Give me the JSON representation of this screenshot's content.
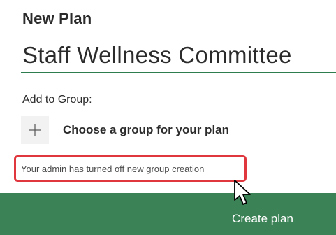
{
  "dialog": {
    "title": "New Plan",
    "plan_name_value": "Staff Wellness Committee",
    "add_to_group_label": "Add to Group:",
    "choose_group_text": "Choose a group for your plan",
    "warning_text": "Your admin has turned off new group creation",
    "create_plan_label": "Create plan"
  },
  "colors": {
    "accent_green": "#3c8257",
    "warning_red": "#e0363d",
    "field_underline": "#2e7d4f"
  },
  "icons": {
    "add_group": "plus-icon",
    "pointer": "mouse-pointer-icon"
  }
}
